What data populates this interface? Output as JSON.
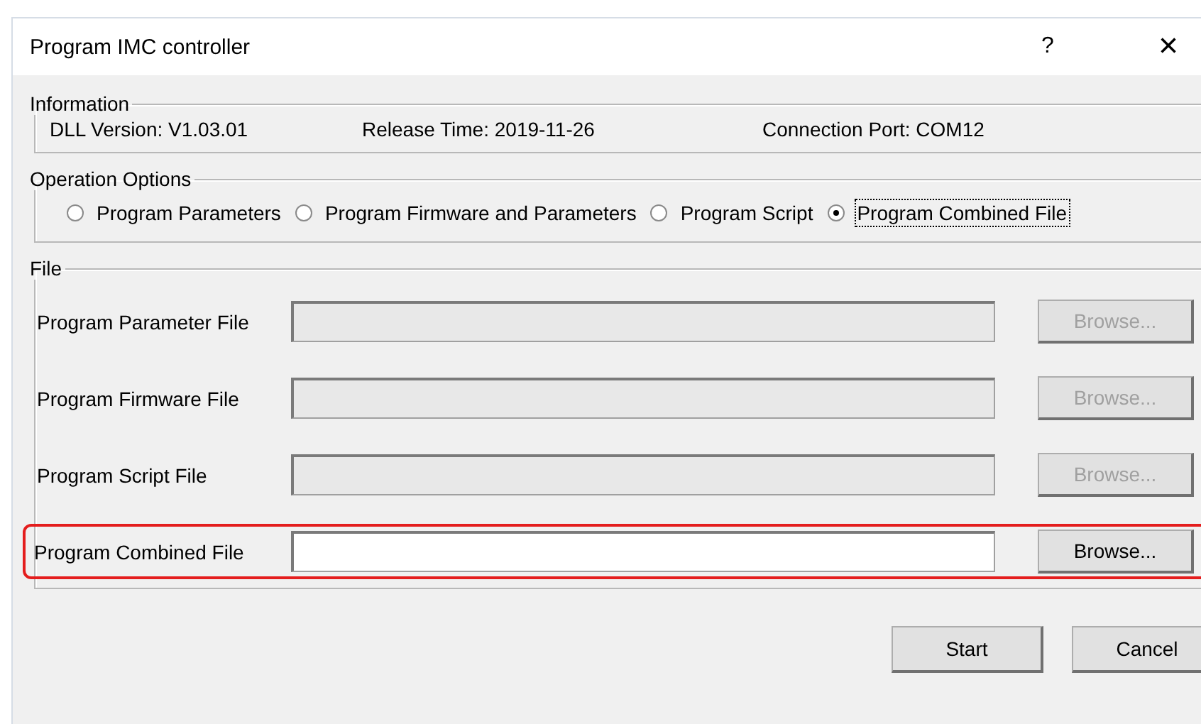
{
  "window": {
    "title": "Program  IMC controller",
    "help": "?",
    "close": "×"
  },
  "information": {
    "title": "Information",
    "items": [
      "DLL Version: V1.03.01",
      "Release Time: 2019-11-26",
      "Connection Port: COM12"
    ]
  },
  "operation_options": {
    "title": "Operation Options",
    "options": [
      {
        "label": "Program Parameters",
        "selected": false
      },
      {
        "label": "Program Firmware and Parameters",
        "selected": false
      },
      {
        "label": "Program Script",
        "selected": false
      },
      {
        "label": "Program Combined File",
        "selected": true
      }
    ]
  },
  "file": {
    "title": "File",
    "rows": [
      {
        "label": "Program Parameter File",
        "button": "Browse...",
        "disabled": true,
        "highlighted": false
      },
      {
        "label": "Program Firmware File",
        "button": "Browse...",
        "disabled": true,
        "highlighted": false
      },
      {
        "label": "Program Script File",
        "button": "Browse...",
        "disabled": true,
        "highlighted": false
      },
      {
        "label": "Program Combined File",
        "button": "Browse...",
        "disabled": false,
        "highlighted": true
      }
    ]
  },
  "buttons": [
    "Start",
    "Cancel"
  ]
}
